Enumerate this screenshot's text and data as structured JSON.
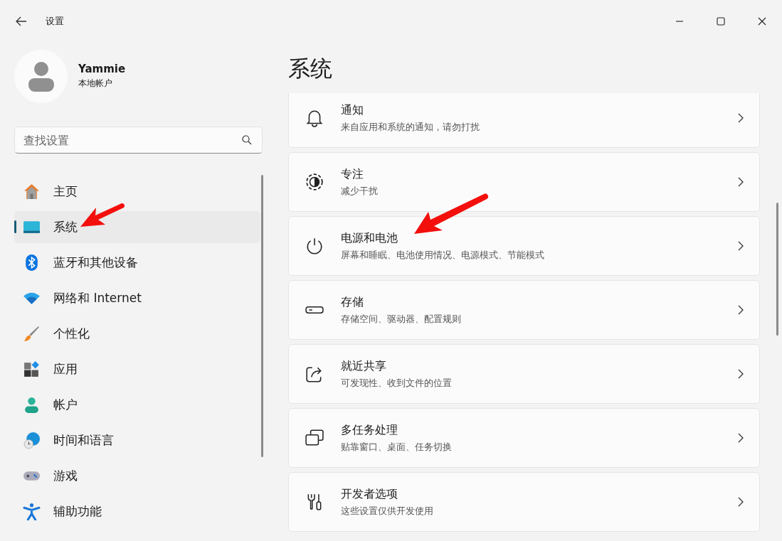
{
  "window": {
    "title": "设置"
  },
  "user": {
    "name": "Yammie",
    "account_type": "本地帐户"
  },
  "search": {
    "placeholder": "查找设置"
  },
  "sidebar": {
    "items": [
      {
        "label": "主页",
        "selected": false
      },
      {
        "label": "系统",
        "selected": true
      },
      {
        "label": "蓝牙和其他设备",
        "selected": false
      },
      {
        "label": "网络和 Internet",
        "selected": false
      },
      {
        "label": "个性化",
        "selected": false
      },
      {
        "label": "应用",
        "selected": false
      },
      {
        "label": "帐户",
        "selected": false
      },
      {
        "label": "时间和语言",
        "selected": false
      },
      {
        "label": "游戏",
        "selected": false
      },
      {
        "label": "辅助功能",
        "selected": false
      }
    ]
  },
  "page": {
    "title": "系统",
    "cards": [
      {
        "title": "通知",
        "subtitle": "来自应用和系统的通知，请勿打扰"
      },
      {
        "title": "专注",
        "subtitle": "减少干扰"
      },
      {
        "title": "电源和电池",
        "subtitle": "屏幕和睡眠、电池使用情况、电源模式、节能模式"
      },
      {
        "title": "存储",
        "subtitle": "存储空间、驱动器、配置规则"
      },
      {
        "title": "就近共享",
        "subtitle": "可发现性、收到文件的位置"
      },
      {
        "title": "多任务处理",
        "subtitle": "贴靠窗口、桌面、任务切换"
      },
      {
        "title": "开发者选项",
        "subtitle": "这些设置仅供开发使用"
      }
    ]
  }
}
